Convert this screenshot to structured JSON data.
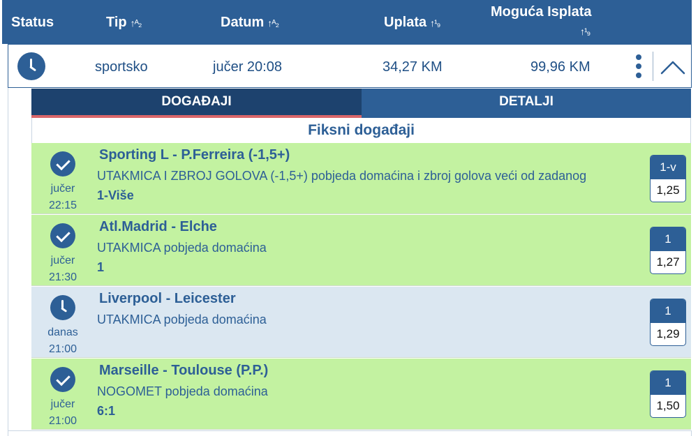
{
  "header": {
    "status": "Status",
    "tip": "Tip",
    "datum": "Datum",
    "uplata": "Uplata",
    "isplata": "Moguća Isplata",
    "sort_alpha": "↑ᴬ₂",
    "sort_num": "↑¹₉"
  },
  "ticket": {
    "status_icon": "clock-icon",
    "tip": "sportsko",
    "datum": "jučer 20:08",
    "uplata": "34,27 KM",
    "isplata": "99,96 KM"
  },
  "tabs": [
    {
      "label": "DOGAĐAJI",
      "active": true
    },
    {
      "label": "DETALJI",
      "active": false
    }
  ],
  "section_title": "Fiksni događaji",
  "events": [
    {
      "status": "won",
      "icon": "check-icon",
      "day": "jučer",
      "time": "22:15",
      "match": "Sporting L - P.Ferreira (-1,5+)",
      "desc": "UTAKMICA I ZBROJ GOLOVA (-1,5+) pobjeda domaćina i zbroj golova veći od zadanog",
      "pick": "1-Više",
      "odd_tip": "1-v",
      "odd_val": "1,25"
    },
    {
      "status": "won",
      "icon": "check-icon",
      "day": "jučer",
      "time": "21:30",
      "match": "Atl.Madrid - Elche",
      "desc": "UTAKMICA pobjeda domaćina",
      "pick": "1",
      "odd_tip": "1",
      "odd_val": "1,27"
    },
    {
      "status": "pending",
      "icon": "clock-icon",
      "day": "danas",
      "time": "21:00",
      "match": "Liverpool - Leicester",
      "desc": "UTAKMICA pobjeda domaćina",
      "pick": "",
      "odd_tip": "1",
      "odd_val": "1,29"
    },
    {
      "status": "won",
      "icon": "check-icon",
      "day": "jučer",
      "time": "21:00",
      "match": "Marseille - Toulouse (P.P.)",
      "desc": "NOGOMET pobjeda domaćina",
      "pick": "6:1",
      "odd_tip": "1",
      "odd_val": "1,50"
    }
  ],
  "colors": {
    "primary": "#2d5f96",
    "tab_active": "#1d426e",
    "tab_underline": "#d9666a",
    "won_bg": "#c3f2a1",
    "pending_bg": "#dbe7f1"
  }
}
